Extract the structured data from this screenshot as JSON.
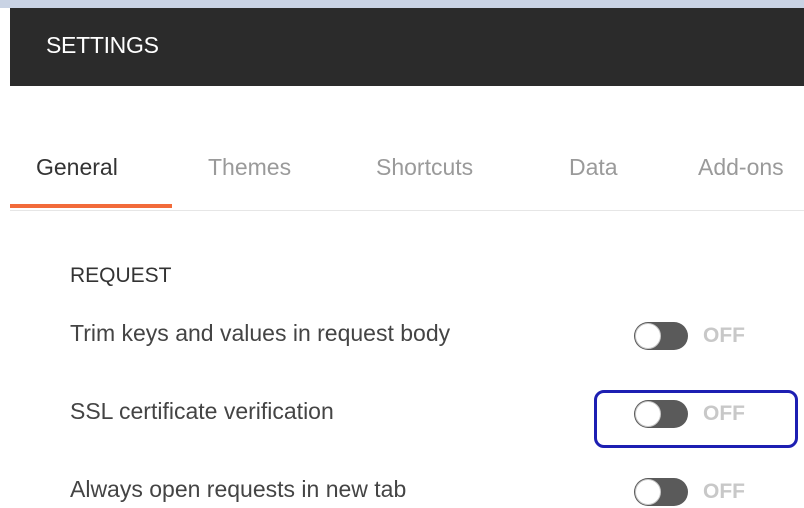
{
  "header": {
    "title": "SETTINGS"
  },
  "tabs": [
    {
      "label": "General",
      "active": true
    },
    {
      "label": "Themes",
      "active": false
    },
    {
      "label": "Shortcuts",
      "active": false
    },
    {
      "label": "Data",
      "active": false
    },
    {
      "label": "Add-ons",
      "active": false
    }
  ],
  "section": {
    "title": "REQUEST",
    "rows": [
      {
        "label": "Trim keys and values in request body",
        "toggle": "OFF"
      },
      {
        "label": "SSL certificate verification",
        "toggle": "OFF"
      },
      {
        "label": "Always open requests in new tab",
        "toggle": "OFF"
      }
    ]
  },
  "colors": {
    "header_bg": "#2b2b2b",
    "accent": "#f26b3a",
    "highlight": "#1d1fb2"
  }
}
